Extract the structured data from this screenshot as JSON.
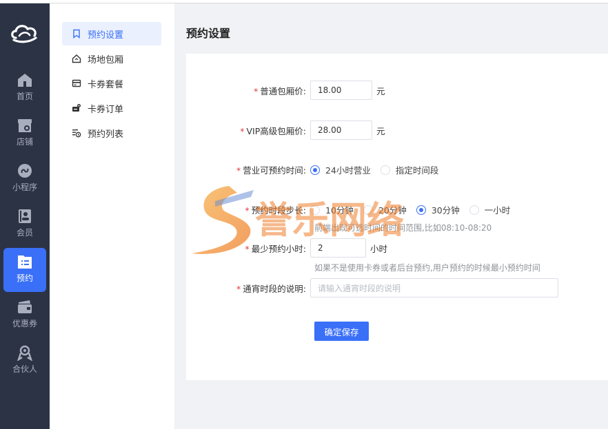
{
  "rail": {
    "items": [
      {
        "label": "首页",
        "icon": "home-icon"
      },
      {
        "label": "店铺",
        "icon": "store-icon"
      },
      {
        "label": "小程序",
        "icon": "miniprogram-icon"
      },
      {
        "label": "会员",
        "icon": "member-icon"
      },
      {
        "label": "预约",
        "icon": "booking-icon",
        "active": true
      },
      {
        "label": "优惠券",
        "icon": "coupon-icon"
      },
      {
        "label": "合伙人",
        "icon": "partner-icon"
      }
    ]
  },
  "submenu": {
    "items": [
      {
        "label": "预约设置",
        "active": true
      },
      {
        "label": "场地包厢"
      },
      {
        "label": "卡券套餐"
      },
      {
        "label": "卡券订单"
      },
      {
        "label": "预约列表"
      }
    ]
  },
  "page": {
    "title": "预约设置"
  },
  "form": {
    "normal_price": {
      "label": "普通包厢价:",
      "value": "18.00",
      "unit": "元"
    },
    "vip_price": {
      "label": "VIP高级包厢价:",
      "value": "28.00",
      "unit": "元"
    },
    "business_time": {
      "label": "营业可预约时间:",
      "options": [
        "24小时营业",
        "指定时间段"
      ],
      "selected": "24小时营业"
    },
    "step": {
      "label": "预约时段步长:",
      "options": [
        "10分钟",
        "20分钟",
        "30分钟",
        "一小时"
      ],
      "selected": "30分钟",
      "hint": "前端出现可选时间的时间范围,比如08:10-08:20"
    },
    "min_hours": {
      "label": "最少预约小时:",
      "value": "2",
      "unit": "小时",
      "hint": "如果不是使用卡券或者后台预约,用户预约的时候最小预约时间"
    },
    "overnight_desc": {
      "label": "通宵时段的说明:",
      "placeholder": "请输入通宵时段的说明"
    },
    "save_label": "确定保存"
  },
  "watermark": {
    "text": "誉乐网络"
  },
  "colors": {
    "primary": "#3a6ff7",
    "rail_bg": "#2c3345",
    "required": "#e4393c"
  }
}
